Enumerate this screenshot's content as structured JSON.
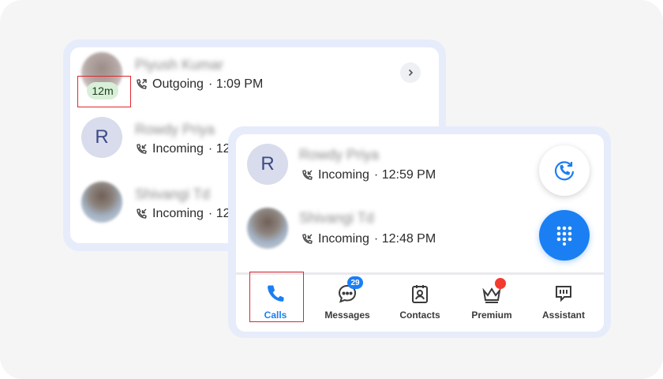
{
  "back_list": {
    "rows": [
      {
        "name": "Piyush Kumar",
        "direction": "Outgoing",
        "time": "· 1:09 PM",
        "duration_badge": "12m",
        "avatar_type": "photo"
      },
      {
        "name": "Rowdy Priya",
        "direction": "Incoming",
        "time": "· 12",
        "avatar_letter": "R",
        "avatar_type": "letter"
      },
      {
        "name": "Shivangi Td",
        "direction": "Incoming",
        "time": "· 12",
        "avatar_type": "photo"
      }
    ]
  },
  "front_list": {
    "rows": [
      {
        "name": "Rowdy Priya",
        "direction": "Incoming",
        "time": "· 12:59 PM",
        "avatar_letter": "R",
        "avatar_type": "letter"
      },
      {
        "name": "Shivangi Td",
        "direction": "Incoming",
        "time": "· 12:48 PM",
        "avatar_type": "photo"
      }
    ]
  },
  "nav": {
    "items": [
      {
        "label": "Calls",
        "icon": "phone-icon",
        "active": true
      },
      {
        "label": "Messages",
        "icon": "message-icon",
        "badge": "29"
      },
      {
        "label": "Contacts",
        "icon": "contacts-icon"
      },
      {
        "label": "Premium",
        "icon": "crown-icon",
        "dot": true
      },
      {
        "label": "Assistant",
        "icon": "assistant-icon"
      }
    ]
  },
  "colors": {
    "accent": "#1a7ff3",
    "highlight_box": "#e0262c",
    "badge_green": "#d8efd8",
    "notification_dot": "#f23a2f"
  }
}
